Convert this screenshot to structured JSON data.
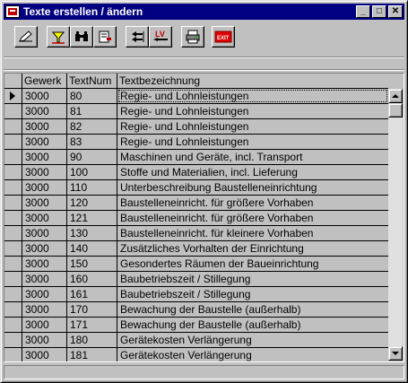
{
  "window": {
    "title": "Texte erstellen / ändern",
    "controls": {
      "minimize": "_",
      "maximize": "□",
      "close": "✕"
    }
  },
  "toolbar": {
    "buttons": [
      {
        "icon": "edit-pencil-icon"
      },
      {
        "icon": "filter-icon"
      },
      {
        "icon": "binoculars-search-icon"
      },
      {
        "icon": "open-document-icon"
      },
      {
        "icon": "import-arrows-icon"
      },
      {
        "icon": "lv-transfer-icon",
        "label": "LV"
      },
      {
        "icon": "printer-icon"
      },
      {
        "icon": "exit-icon",
        "label": "EXIT"
      }
    ]
  },
  "grid": {
    "columns": [
      "Gewerk",
      "TextNum",
      "Textbezeichnung"
    ],
    "rows": [
      [
        "3000",
        "80",
        "Regie- und Lohnleistungen"
      ],
      [
        "3000",
        "81",
        "Regie- und Lohnleistungen"
      ],
      [
        "3000",
        "82",
        "Regie- und Lohnleistungen"
      ],
      [
        "3000",
        "83",
        "Regie- und Lohnleistungen"
      ],
      [
        "3000",
        "90",
        "Maschinen und Geräte, incl. Transport"
      ],
      [
        "3000",
        "100",
        "Stoffe und Materialien, incl. Lieferung"
      ],
      [
        "3000",
        "110",
        "Unterbeschreibung Baustelleneinrichtung"
      ],
      [
        "3000",
        "120",
        "Baustelleneinricht. für größere Vorhaben"
      ],
      [
        "3000",
        "121",
        "Baustelleneinricht. für größere Vorhaben"
      ],
      [
        "3000",
        "130",
        "Baustelleneinricht. für kleinere Vorhaben"
      ],
      [
        "3000",
        "140",
        "Zusätzliches Vorhalten der Einrichtung"
      ],
      [
        "3000",
        "150",
        "Gesondertes Räumen der Baueinrichtung"
      ],
      [
        "3000",
        "160",
        "Baubetriebszeit / Stillegung"
      ],
      [
        "3000",
        "161",
        "Baubetriebszeit / Stillegung"
      ],
      [
        "3000",
        "170",
        "Bewachung der Baustelle (außerhalb)"
      ],
      [
        "3000",
        "171",
        "Bewachung der Baustelle (außerhalb)"
      ],
      [
        "3000",
        "180",
        "Gerätekosten Verlängerung"
      ],
      [
        "3000",
        "181",
        "Gerätekosten Verlängerung"
      ]
    ],
    "current_row_index": 0
  },
  "colors": {
    "titlebar": "#000080",
    "face": "#c0c0c0",
    "exit_red": "#e00000"
  }
}
